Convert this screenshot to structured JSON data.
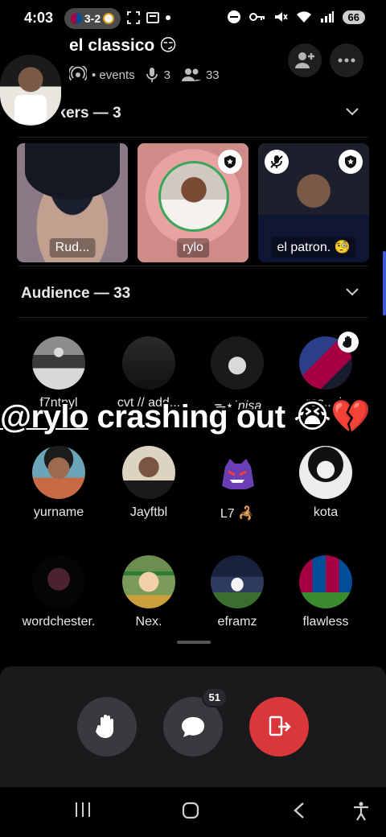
{
  "status": {
    "time": "4:03",
    "score": "3-2",
    "battery": "66"
  },
  "header": {
    "title": "el classico 😏",
    "events_label": "• events",
    "speaker_count": "3",
    "member_count": "33"
  },
  "speakers": {
    "heading": "Speakers — 3",
    "cards": [
      {
        "name": "Rud..."
      },
      {
        "name": "rylo"
      },
      {
        "name": "el patron. 🧐"
      }
    ]
  },
  "audience": {
    "heading": "Audience — 33",
    "members": [
      {
        "name": "f7ntnyl"
      },
      {
        "name": "cvt // add..."
      },
      {
        "name": "ᯓ⋆˙nisa"
      },
      {
        "name": "ros...rk"
      },
      {
        "name": "yurname"
      },
      {
        "name": "Jayftbl"
      },
      {
        "name": "L7 🦂"
      },
      {
        "name": "kota"
      },
      {
        "name": "wordchester."
      },
      {
        "name": "Nex."
      },
      {
        "name": "eframz"
      },
      {
        "name": "flawless"
      }
    ]
  },
  "caption": {
    "mention": "@rylo",
    "text": " crashing out 😭💔"
  },
  "controls": {
    "chat_badge": "51"
  },
  "colors": {
    "accent_green": "#3ba55d",
    "leave_red": "#da373c",
    "background": "#000000",
    "panel": "#1a1a1c"
  }
}
